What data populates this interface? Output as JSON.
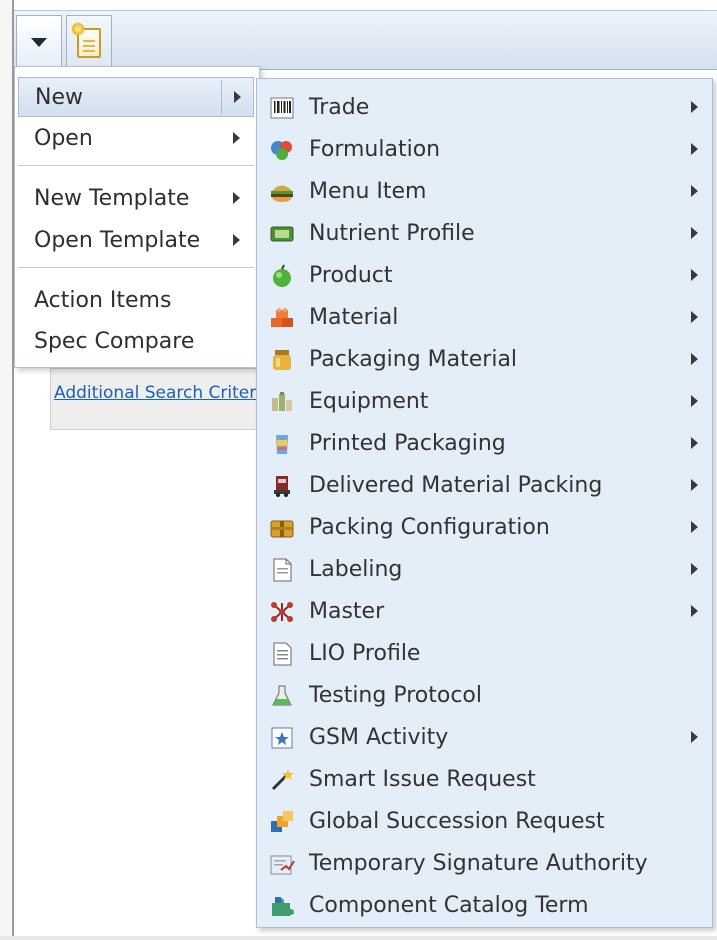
{
  "primary_menu": {
    "items": [
      {
        "label": "New",
        "has_submenu": true,
        "active": true
      },
      {
        "label": "Open",
        "has_submenu": true
      },
      {
        "label": "New Template",
        "has_submenu": true
      },
      {
        "label": "Open Template",
        "has_submenu": true
      },
      {
        "label": "Action Items",
        "has_submenu": false
      },
      {
        "label": "Spec Compare",
        "has_submenu": false
      }
    ]
  },
  "background": {
    "search_link": "Additional Search Criteria"
  },
  "new_submenu": {
    "items": [
      {
        "label": "Trade",
        "icon": "barcode-icon",
        "has_submenu": true
      },
      {
        "label": "Formulation",
        "icon": "formulation-icon",
        "has_submenu": true
      },
      {
        "label": "Menu Item",
        "icon": "burger-icon",
        "has_submenu": true
      },
      {
        "label": "Nutrient Profile",
        "icon": "nutrient-profile-icon",
        "has_submenu": true
      },
      {
        "label": "Product",
        "icon": "apple-icon",
        "has_submenu": true
      },
      {
        "label": "Material",
        "icon": "bricks-icon",
        "has_submenu": true
      },
      {
        "label": "Packaging Material",
        "icon": "jar-icon",
        "has_submenu": true
      },
      {
        "label": "Equipment",
        "icon": "equipment-icon",
        "has_submenu": true
      },
      {
        "label": "Printed Packaging",
        "icon": "printed-package-icon",
        "has_submenu": true
      },
      {
        "label": "Delivered Material Packing",
        "icon": "truck-icon",
        "has_submenu": true
      },
      {
        "label": "Packing Configuration",
        "icon": "box-icon",
        "has_submenu": true
      },
      {
        "label": "Labeling",
        "icon": "label-document-icon",
        "has_submenu": true
      },
      {
        "label": "Master",
        "icon": "master-molecule-icon",
        "has_submenu": true
      },
      {
        "label": "LIO Profile",
        "icon": "document-lines-icon",
        "has_submenu": false
      },
      {
        "label": "Testing Protocol",
        "icon": "flask-icon",
        "has_submenu": false
      },
      {
        "label": "GSM Activity",
        "icon": "star-document-icon",
        "has_submenu": true
      },
      {
        "label": "Smart Issue Request",
        "icon": "magic-wand-icon",
        "has_submenu": false
      },
      {
        "label": "Global Succession Request",
        "icon": "succession-icon",
        "has_submenu": false
      },
      {
        "label": "Temporary Signature Authority",
        "icon": "signature-icon",
        "has_submenu": false
      },
      {
        "label": "Component Catalog Term",
        "icon": "puzzle-icon",
        "has_submenu": false
      }
    ]
  },
  "colors": {
    "menu_background": "#e4eef8",
    "active_item": "#d2dfee",
    "link": "#1f5fb6"
  }
}
